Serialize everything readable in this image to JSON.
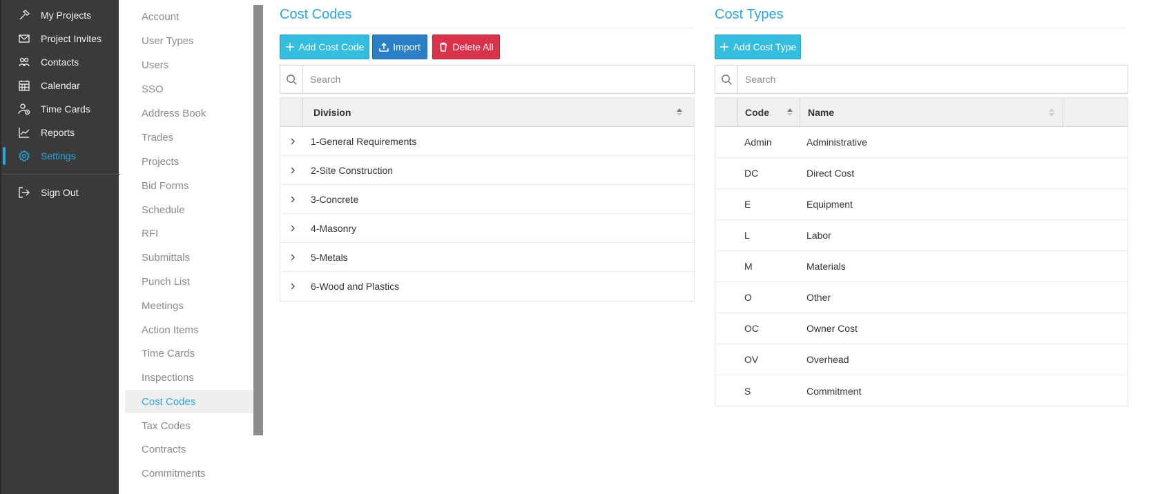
{
  "nav": {
    "items": [
      {
        "label": "My Projects",
        "icon": "hammer-icon"
      },
      {
        "label": "Project Invites",
        "icon": "envelope-icon"
      },
      {
        "label": "Contacts",
        "icon": "people-icon"
      },
      {
        "label": "Calendar",
        "icon": "calendar-icon"
      },
      {
        "label": "Time Cards",
        "icon": "person-clock-icon"
      },
      {
        "label": "Reports",
        "icon": "line-chart-icon"
      },
      {
        "label": "Settings",
        "icon": "gear-icon"
      }
    ],
    "sign_out": {
      "label": "Sign Out",
      "icon": "sign-out-icon"
    }
  },
  "settings_menu": {
    "items": [
      "Account",
      "User Types",
      "Users",
      "SSO",
      "Address Book",
      "Trades",
      "Projects",
      "Bid Forms",
      "Schedule",
      "RFI",
      "Submittals",
      "Punch List",
      "Meetings",
      "Action Items",
      "Time Cards",
      "Inspections",
      "Cost Codes",
      "Tax Codes",
      "Contracts",
      "Commitments"
    ],
    "active": "Cost Codes"
  },
  "cost_codes": {
    "title": "Cost Codes",
    "add_label": "Add Cost Code",
    "import_label": "Import",
    "delete_all_label": "Delete All",
    "search_placeholder": "Search",
    "column_division": "Division",
    "rows": [
      "1-General Requirements",
      "2-Site Construction",
      "3-Concrete",
      "4-Masonry",
      "5-Metals",
      "6-Wood and Plastics"
    ]
  },
  "cost_types": {
    "title": "Cost Types",
    "add_label": "Add Cost Type",
    "search_placeholder": "Search",
    "column_code": "Code",
    "column_name": "Name",
    "rows": [
      {
        "code": "Admin",
        "name": "Administrative"
      },
      {
        "code": "DC",
        "name": "Direct Cost"
      },
      {
        "code": "E",
        "name": "Equipment"
      },
      {
        "code": "L",
        "name": "Labor"
      },
      {
        "code": "M",
        "name": "Materials"
      },
      {
        "code": "O",
        "name": "Other"
      },
      {
        "code": "OC",
        "name": "Owner Cost"
      },
      {
        "code": "OV",
        "name": "Overhead"
      },
      {
        "code": "S",
        "name": "Commitment"
      }
    ]
  },
  "colors": {
    "accent": "#2aa6dc",
    "nav_bg": "#3a3a3a",
    "info": "#35bde0",
    "primary": "#2a7fc6",
    "danger": "#d9334b"
  }
}
